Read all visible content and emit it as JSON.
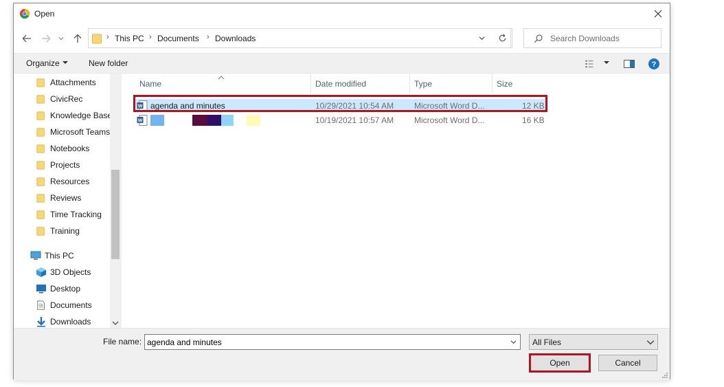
{
  "window": {
    "title": "Open"
  },
  "address": {
    "crumbs": [
      "This PC",
      "Documents",
      "Downloads"
    ],
    "separator": "›"
  },
  "search": {
    "placeholder": "Search Downloads"
  },
  "toolbar": {
    "organize": "Organize",
    "new_folder": "New folder"
  },
  "nav": {
    "items": [
      {
        "label": "Attachments",
        "icon": "folder-icon"
      },
      {
        "label": "CivicRec",
        "icon": "folder-icon"
      },
      {
        "label": "Knowledge Base",
        "icon": "folder-icon"
      },
      {
        "label": "Microsoft Teams",
        "icon": "folder-icon"
      },
      {
        "label": "Notebooks",
        "icon": "folder-icon"
      },
      {
        "label": "Projects",
        "icon": "folder-icon"
      },
      {
        "label": "Resources",
        "icon": "folder-icon"
      },
      {
        "label": "Reviews",
        "icon": "folder-icon"
      },
      {
        "label": "Time Tracking",
        "icon": "folder-icon"
      },
      {
        "label": "Training",
        "icon": "folder-icon"
      },
      {
        "label": "This PC",
        "icon": "computer-icon"
      },
      {
        "label": "3D Objects",
        "icon": "cube-icon"
      },
      {
        "label": "Desktop",
        "icon": "desktop-icon"
      },
      {
        "label": "Documents",
        "icon": "document-icon"
      },
      {
        "label": "Downloads",
        "icon": "download-arrow-icon"
      }
    ]
  },
  "columns": {
    "name": "Name",
    "date": "Date modified",
    "type": "Type",
    "size": "Size"
  },
  "files": [
    {
      "name": "agenda and minutes",
      "date": "10/29/2021 10:54 AM",
      "type": "Microsoft Word D...",
      "size": "12 KB"
    },
    {
      "name": "",
      "date": "10/19/2021 10:57 AM",
      "type": "Microsoft Word D...",
      "size": "16 KB"
    }
  ],
  "bottom": {
    "filename_label": "File name:",
    "filename_value": "agenda and minutes",
    "filetype": "All Files",
    "open": "Open",
    "cancel": "Cancel"
  },
  "colors": {
    "highlight": "#b5121b",
    "selection": "#cce8ff",
    "folder": "#f8d775",
    "accent": "#0078d7"
  }
}
